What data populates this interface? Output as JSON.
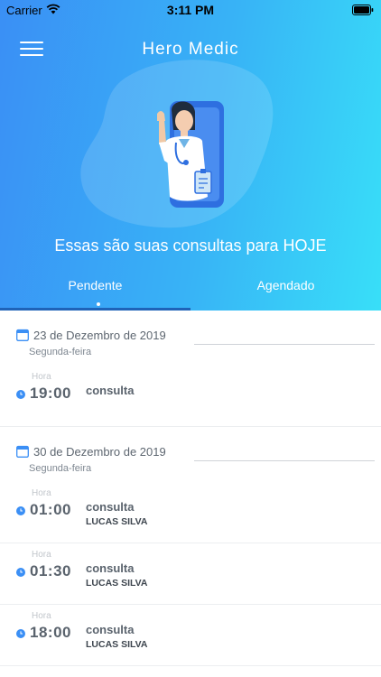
{
  "status_bar": {
    "carrier": "Carrier",
    "time": "3:11 PM"
  },
  "header": {
    "title": "Hero Medic",
    "headline": "Essas são suas consultas para HOJE",
    "colors": {
      "gradient_start": "#3a8ff5",
      "gradient_end": "#38dff8",
      "tab_indicator": "#1f63b8"
    }
  },
  "tabs": [
    {
      "label": "Pendente",
      "selected": true
    },
    {
      "label": "Agendado",
      "selected": false
    }
  ],
  "groups": [
    {
      "date": "23 de Dezembro de 2019",
      "weekday": "Segunda-feira",
      "appointments": [
        {
          "hora_label": "Hora",
          "time": "19:00",
          "title": "consulta",
          "patient": ""
        }
      ]
    },
    {
      "date": "30 de Dezembro de 2019",
      "weekday": "Segunda-feira",
      "appointments": [
        {
          "hora_label": "Hora",
          "time": "01:00",
          "title": "consulta",
          "patient": "LUCAS SILVA"
        },
        {
          "hora_label": "Hora",
          "time": "01:30",
          "title": "consulta",
          "patient": "LUCAS SILVA"
        },
        {
          "hora_label": "Hora",
          "time": "18:00",
          "title": "consulta",
          "patient": "LUCAS SILVA"
        }
      ]
    }
  ]
}
